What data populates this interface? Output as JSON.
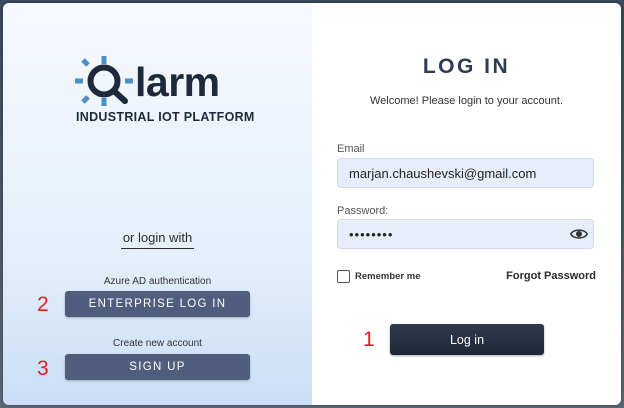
{
  "brand": {
    "wordmark": "larm",
    "tagline": "INDUSTRIAL IOT PLATFORM",
    "colors": {
      "rays": "#4a90c8",
      "ring": "#1e2a3b"
    }
  },
  "alt_login": {
    "heading": "or login with",
    "azure_caption": "Azure AD authentication",
    "enterprise_button": "ENTERPRISE LOG IN",
    "signup_caption": "Create new account",
    "signup_button": "SIGN UP"
  },
  "markers": [
    "1",
    "2",
    "3"
  ],
  "form": {
    "title": "LOG IN",
    "welcome": "Welcome! Please login to your account.",
    "email_label": "Email",
    "email_value": "marjan.chaushevski@gmail.com",
    "password_label": "Password:",
    "password_value": "••••••••",
    "remember_label": "Remember me",
    "remember_checked": false,
    "forgot_link": "Forgot Password",
    "login_button": "Log in"
  },
  "icons": [
    "logo-sun-icon",
    "eye-icon",
    "checkbox-icon"
  ]
}
